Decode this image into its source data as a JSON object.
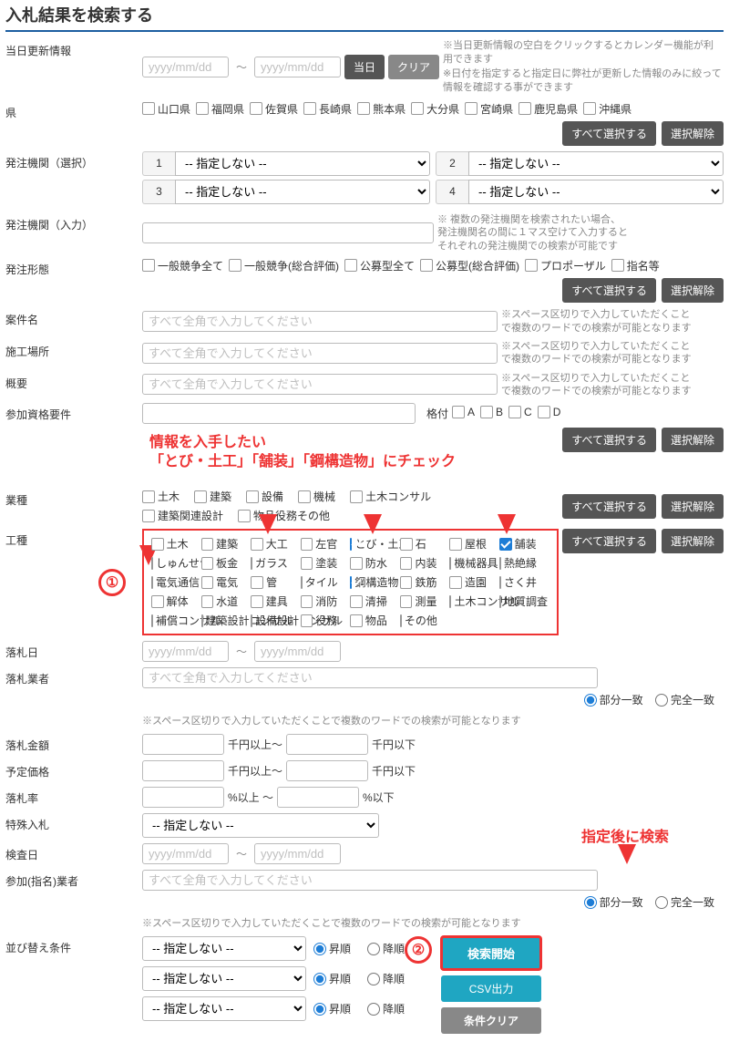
{
  "title": "入札結果を検索する",
  "date_ph": "yyyy/mm/dd",
  "update": {
    "label": "当日更新情報",
    "btn_today": "当日",
    "btn_clear": "クリア",
    "note": "※当日更新情報の空白をクリックするとカレンダー機能が利用できます\n※日付を指定すると指定日に弊社が更新した情報のみに絞って情報を確認する事ができます"
  },
  "pref": {
    "label": "県",
    "items": [
      "山口県",
      "福岡県",
      "佐賀県",
      "長崎県",
      "熊本県",
      "大分県",
      "宮崎県",
      "鹿児島県",
      "沖縄県"
    ]
  },
  "btns": {
    "all": "すべて選択する",
    "clear": "選択解除"
  },
  "agency_sel": {
    "label": "発注機関（選択）",
    "opt": "-- 指定しない --"
  },
  "agency_in": {
    "label": "発注機関（入力）",
    "note": "※ 複数の発注機関を検索されたい場合、発注機関名の間に１マス空けて入力するとそれぞれの発注機関での検索が可能です"
  },
  "form": {
    "label": "発注形態",
    "items": [
      "一般競争全て",
      "一般競争(総合評価)",
      "公募型全て",
      "公募型(総合評価)",
      "プロポーザル",
      "指名等"
    ]
  },
  "proj": {
    "label": "案件名",
    "ph": "すべて全角で入力してください",
    "note": "※スペース区切りで入力していただくことで複数のワードでの検索が可能となります"
  },
  "place": {
    "label": "施工場所"
  },
  "summary": {
    "label": "概要"
  },
  "req": {
    "label": "参加資格要件",
    "rank": "格付",
    "ranks": [
      "A",
      "B",
      "C",
      "D"
    ]
  },
  "industry": {
    "label": "業種",
    "items": [
      "土木",
      "建築",
      "設備",
      "機械",
      "土木コンサル",
      "建築関連設計",
      "物品役務その他"
    ]
  },
  "callout": "情報を入手したい\n「とび・土工」「舗装」「鋼構造物」にチェック",
  "work": {
    "label": "工種",
    "items": [
      "土木",
      "建築",
      "大工",
      "左官",
      "とび・土工",
      "石",
      "屋根",
      "舗装",
      "しゅんせつ",
      "板金",
      "ガラス",
      "塗装",
      "防水",
      "内装",
      "機械器具",
      "熱絶縁",
      "電気通信",
      "電気",
      "管",
      "タイル",
      "鋼構造物",
      "鉄筋",
      "造園",
      "さく井",
      "解体",
      "水道",
      "建具",
      "消防",
      "清掃",
      "測量",
      "土木コンサル",
      "地質調査",
      "補償コンサル",
      "建築設計コンサル",
      "設備設計コンサル",
      "役務",
      "物品",
      "その他"
    ],
    "checked": [
      4,
      7,
      20
    ]
  },
  "award_date": {
    "label": "落札日"
  },
  "award_co": {
    "label": "落札業者",
    "r1": "部分一致",
    "r2": "完全一致",
    "note": "※スペース区切りで入力していただくことで複数のワードでの検索が可能となります"
  },
  "amount": {
    "label": "落札金額",
    "u1": "千円以上～",
    "u2": "千円以下"
  },
  "est": {
    "label": "予定価格"
  },
  "rate": {
    "label": "落札率",
    "u1": "%以上 ～",
    "u2": "%以下"
  },
  "special": {
    "label": "特殊入札"
  },
  "inspect": {
    "label": "検査日"
  },
  "nominee": {
    "label": "参加(指名)業者"
  },
  "sort": {
    "label": "並び替え条件",
    "asc": "昇順",
    "desc": "降順"
  },
  "call2": "指定後に検索",
  "actions": {
    "search": "検索開始",
    "csv": "CSV出力",
    "clear": "条件クリア"
  }
}
